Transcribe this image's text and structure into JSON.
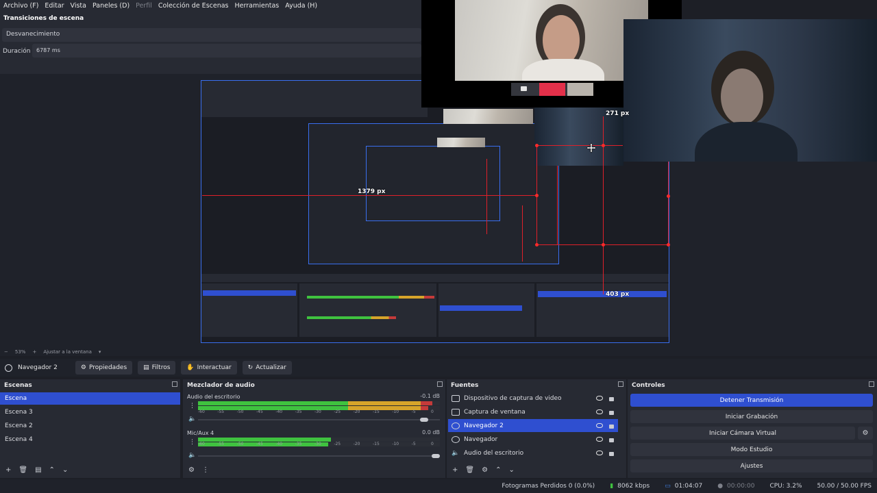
{
  "menu": {
    "archivo": "Archivo (F)",
    "editar": "Editar",
    "vista": "Vista",
    "paneles": "Paneles (D)",
    "perfil": "Perfil",
    "colecciones": "Colección de Escenas",
    "herramientas": "Herramientas",
    "ayuda": "Ayuda (H)"
  },
  "transitions": {
    "title": "Transiciones de escena",
    "selected": "Desvanecimiento",
    "duration_label": "Duración",
    "duration_value": "6787 ms"
  },
  "preview": {
    "labels": {
      "width_main": "1379 px",
      "right_top": "271 px",
      "bottom": "403 px"
    }
  },
  "zoom": {
    "minus": "−",
    "value": "53%",
    "plus": "+",
    "fit": "Ajustar a la ventana"
  },
  "source_toolbar": {
    "selected_source": "Navegador 2",
    "properties": "Propiedades",
    "filters": "Filtros",
    "interact": "Interactuar",
    "refresh": "Actualizar"
  },
  "scenes": {
    "title": "Escenas",
    "items": [
      "Escena",
      "Escena 3",
      "Escena 2",
      "Escena 4"
    ],
    "selected_index": 0
  },
  "mixer": {
    "title": "Mezclador de audio",
    "tick_labels": [
      "-60",
      "-55",
      "-50",
      "-45",
      "-40",
      "-35",
      "-30",
      "-25",
      "-20",
      "-15",
      "-10",
      "-5",
      "0"
    ],
    "channels": [
      {
        "name": "Audio del escritorio",
        "db": "-0.1 dB",
        "level": 0.97,
        "volume": 0.95
      },
      {
        "name": "Mic/Aux 4",
        "db": "0.0 dB",
        "level": 0.55,
        "volume": 1.0
      }
    ]
  },
  "sources": {
    "title": "Fuentes",
    "items": [
      {
        "name": "Dispositivo de captura de video",
        "icon": "camera-icon"
      },
      {
        "name": "Captura de ventana",
        "icon": "window-icon"
      },
      {
        "name": "Navegador 2",
        "icon": "globe-icon"
      },
      {
        "name": "Navegador",
        "icon": "globe-icon"
      },
      {
        "name": "Audio del escritorio",
        "icon": "speaker-icon"
      }
    ],
    "selected_index": 2
  },
  "controls": {
    "title": "Controles",
    "stop_stream": "Detener Transmisión",
    "start_record": "Iniciar Grabación",
    "start_vcam": "Iniciar Cámara Virtual",
    "studio_mode": "Modo Estudio",
    "settings": "Ajustes"
  },
  "status": {
    "dropped": "Fotogramas Perdidos 0 (0.0%)",
    "bitrate": "8062 kbps",
    "stream_time": "01:04:07",
    "rec_time": "00:00:00",
    "cpu": "CPU: 3.2%",
    "fps": "50.00 / 50.00 FPS"
  },
  "colors": {
    "accent": "#2f4fd0",
    "guide_red": "#e0202a",
    "panel": "#272a33",
    "background": "#1d1f26"
  }
}
